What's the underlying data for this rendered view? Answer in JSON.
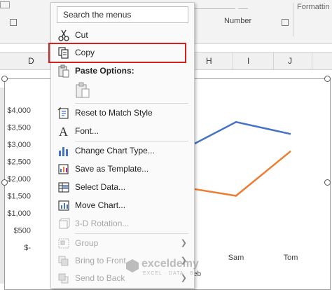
{
  "ribbon": {
    "group_label": "Number",
    "formatting_cut": "Formattin"
  },
  "columns": [
    "D",
    "H",
    "I",
    "J"
  ],
  "chart": {
    "y_ticks": [
      "$4,000",
      "$3,500",
      "$3,000",
      "$2,500",
      "$2,000",
      "$1,500",
      "$1,000",
      "$500",
      "$-"
    ],
    "x_labels": [
      "Sam",
      "Tom"
    ],
    "partial_x_label": "eb",
    "colors": {
      "series1": "#4472c4",
      "series2": "#ed7d31"
    }
  },
  "chart_data": {
    "type": "line",
    "categories": [
      "Sam",
      "Tom"
    ],
    "series": [
      {
        "values": [
          3650,
          3300
        ]
      },
      {
        "values": [
          1500,
          2800
        ]
      }
    ],
    "ylim": [
      0,
      4000
    ],
    "grid": false
  },
  "menu": {
    "search_placeholder": "Search the menus",
    "items": [
      {
        "label": "Cut",
        "icon": "scissors-icon"
      },
      {
        "label": "Copy",
        "icon": "copy-icon"
      },
      {
        "label": "Paste Options:",
        "icon": "paste-icon"
      },
      {
        "label": "Reset to Match Style",
        "icon": "reset-style-icon"
      },
      {
        "label": "Font...",
        "icon": "font-icon"
      },
      {
        "label": "Change Chart Type...",
        "icon": "chart-type-icon"
      },
      {
        "label": "Save as Template...",
        "icon": "save-template-icon"
      },
      {
        "label": "Select Data...",
        "icon": "select-data-icon"
      },
      {
        "label": "Move Chart...",
        "icon": "move-chart-icon"
      },
      {
        "label": "3-D Rotation...",
        "icon": "rotation-icon"
      },
      {
        "label": "Group",
        "icon": "group-icon"
      },
      {
        "label": "Bring to Front",
        "icon": "bring-front-icon"
      },
      {
        "label": "Send to Back",
        "icon": "send-back-icon"
      }
    ]
  },
  "watermark": {
    "name": "exceldemy",
    "tagline": "EXCEL · DATA · BI"
  }
}
